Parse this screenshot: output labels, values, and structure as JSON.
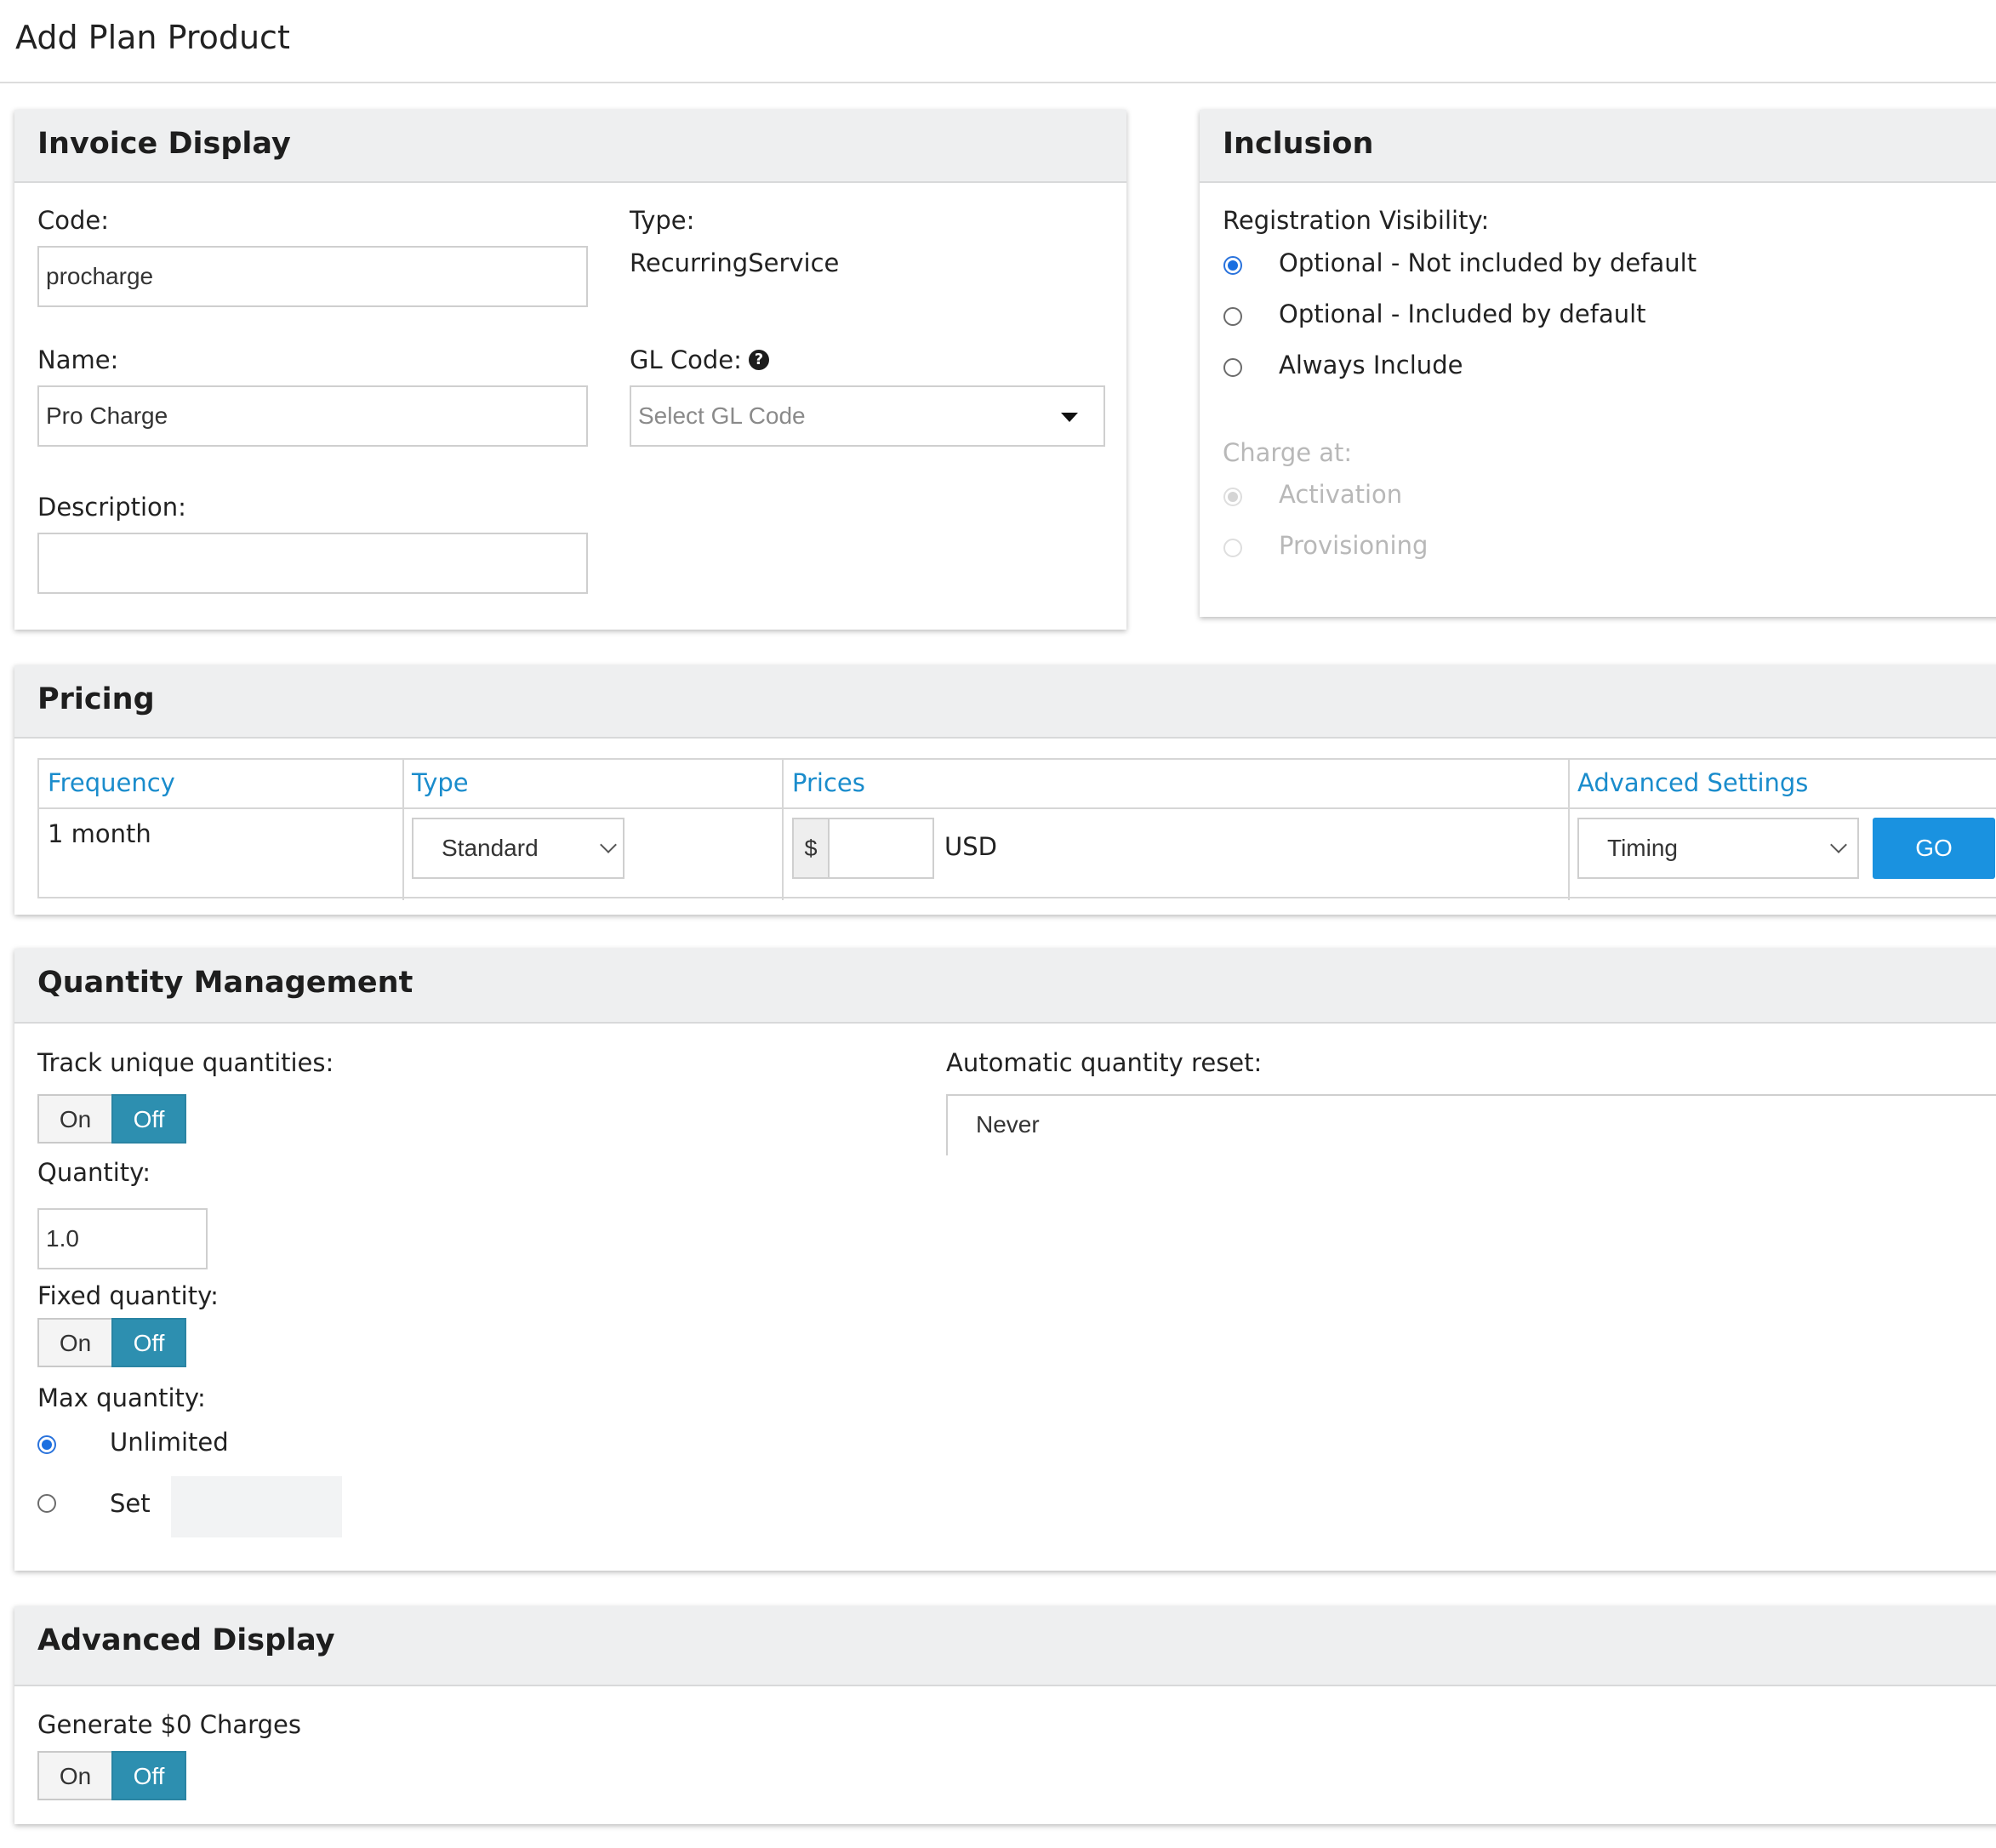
{
  "page": {
    "title": "Add Plan Product"
  },
  "invoice_display": {
    "heading": "Invoice Display",
    "code_label": "Code:",
    "code_value": "procharge",
    "type_label": "Type:",
    "type_value": "RecurringService",
    "name_label": "Name:",
    "name_value": "Pro Charge",
    "gl_code_label": "GL Code:",
    "gl_code_placeholder": "Select GL Code",
    "help_icon": "question-circle-icon",
    "description_label": "Description:",
    "description_value": ""
  },
  "inclusion": {
    "heading": "Inclusion",
    "registration_visibility_label": "Registration Visibility:",
    "options": [
      {
        "label": "Optional - Not included by default",
        "checked": true
      },
      {
        "label": "Optional - Included by default",
        "checked": false
      },
      {
        "label": "Always Include",
        "checked": false
      }
    ],
    "charge_at_label": "Charge at:",
    "charge_at_options": [
      {
        "label": "Activation",
        "checked": true,
        "disabled": true
      },
      {
        "label": "Provisioning",
        "checked": false,
        "disabled": true
      }
    ]
  },
  "pricing": {
    "heading": "Pricing",
    "columns": [
      "Frequency",
      "Type",
      "Prices",
      "Advanced Settings"
    ],
    "row": {
      "frequency": "1 month",
      "type_selected": "Standard",
      "currency_symbol": "$",
      "price_value": "",
      "currency": "USD",
      "advanced_selected": "Timing",
      "go_label": "GO"
    }
  },
  "quantity_management": {
    "heading": "Quantity Management",
    "track_unique_label": "Track unique quantities:",
    "track_unique": {
      "on_label": "On",
      "off_label": "Off",
      "state": "Off"
    },
    "quantity_label": "Quantity:",
    "quantity_value": "1.0",
    "fixed_quantity_label": "Fixed quantity:",
    "fixed_quantity": {
      "on_label": "On",
      "off_label": "Off",
      "state": "Off"
    },
    "max_quantity_label": "Max quantity:",
    "max_options": [
      {
        "label": "Unlimited",
        "checked": true
      },
      {
        "label": "Set",
        "checked": false
      }
    ],
    "max_set_value": "",
    "auto_reset_label": "Automatic quantity reset:",
    "auto_reset_selected": "Never"
  },
  "advanced_display": {
    "heading": "Advanced Display",
    "generate_zero_label": "Generate $0 Charges",
    "generate_zero": {
      "on_label": "On",
      "off_label": "Off",
      "state": "Off"
    }
  },
  "colors": {
    "accent_blue": "#1a8ccc",
    "toggle_active": "#2d8fb0",
    "go_button": "#1a92e0",
    "panel_header": "#eeeff0"
  }
}
